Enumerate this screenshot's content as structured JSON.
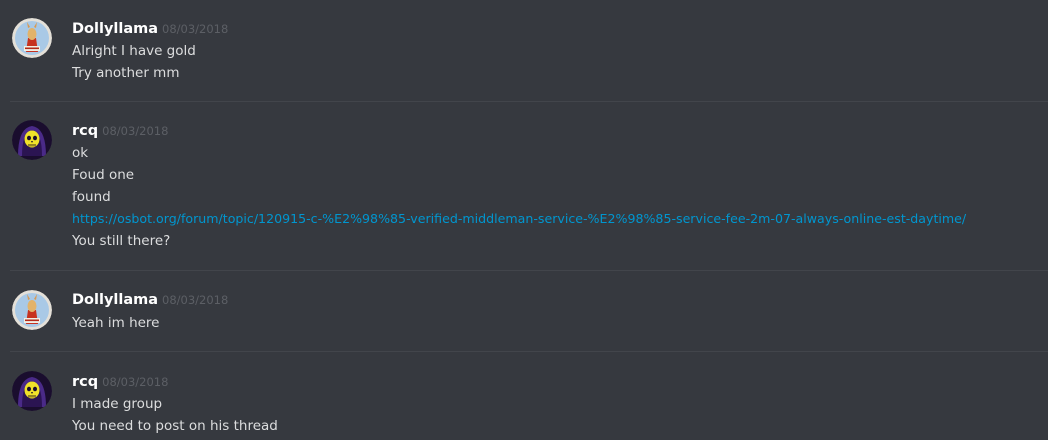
{
  "messages": [
    {
      "author": "Dollyllama",
      "timestamp": "08/03/2018",
      "avatar": "llama-avatar",
      "lines": [
        "Alright I have gold",
        "Try another mm"
      ]
    },
    {
      "author": "rcq",
      "timestamp": "08/03/2018",
      "avatar": "skull-avatar",
      "lines": [
        "ok",
        "Foud one",
        "found",
        "https://osbot.org/forum/topic/120915-c-%E2%98%85-verified-middleman-service-%E2%98%85-service-fee-2m-07-always-online-est-daytime/",
        "You still there?"
      ]
    },
    {
      "author": "Dollyllama",
      "timestamp": "08/03/2018",
      "avatar": "llama-avatar",
      "lines": [
        "Yeah im here"
      ]
    },
    {
      "author": "rcq",
      "timestamp": "08/03/2018",
      "avatar": "skull-avatar",
      "lines": [
        "I made group",
        "You need to post on his thread"
      ]
    }
  ],
  "colors": {
    "background": "#36393f",
    "divider": "#42454b",
    "username": "#ffffff",
    "timestamp": "#5c5f65",
    "text": "#dcddde",
    "link": "#0096cf"
  }
}
